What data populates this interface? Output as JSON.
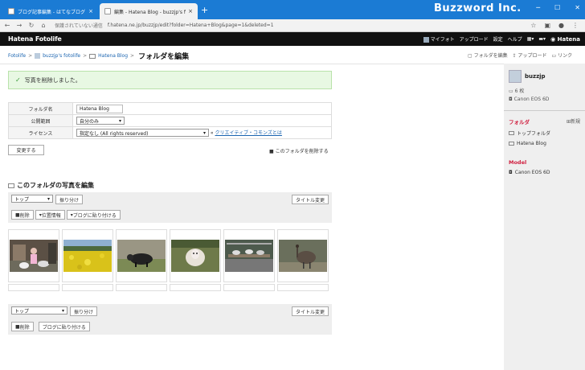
{
  "browser": {
    "tabs": [
      {
        "title": "ブログ記事編集 - はてなブログ"
      },
      {
        "title": "編集 - Hatena Blog - buzzjp's fotolife"
      }
    ],
    "brand": "Buzzword Inc.",
    "security": "保護されていない通信",
    "url": "f.hatena.ne.jp/buzzjp/edit?folder=Hatena+Blog&page=1&deleted=1"
  },
  "header": {
    "logo": "Hatena Fotolife",
    "nav": [
      "マイフォト",
      "アップロード",
      "設定",
      "ヘルプ"
    ],
    "hatena": "Hatena"
  },
  "breadcrumb": {
    "root": "Fotolife",
    "user": "buzzjp's fotolife",
    "folder": "Hatena Blog",
    "current": "フォルダを編集"
  },
  "actions": {
    "edit_folder": "フォルダを編集",
    "upload": "アップロード",
    "link": "リンク"
  },
  "notice": "写真を削除しました。",
  "form": {
    "rows": [
      {
        "label": "フォルダ名",
        "value": "Hatena Blog"
      },
      {
        "label": "公開範囲",
        "value": "自分のみ"
      },
      {
        "label": "ライセンス",
        "value": "指定なし (All rights reserved)"
      }
    ],
    "cc_link": "クリエイティブ・コモンズとは",
    "change_btn": "変更する",
    "delete_folder": "このフォルダを削除する"
  },
  "photos_section": {
    "title": "このフォルダの写真を編集",
    "move_select": "トップ",
    "move_btn": "振り分け",
    "title_btn": "タイトル変更",
    "delete_btn": "削除",
    "location_btn": "位置情報",
    "blog_btn": "ブログに貼り付ける",
    "bottom_blog_btn": "ブログに貼り付ける",
    "photos": [
      {
        "subject": "goats-and-person"
      },
      {
        "subject": "rapeseed-field"
      },
      {
        "subject": "black-sheep"
      },
      {
        "subject": "white-sheep"
      },
      {
        "subject": "goats-on-platform"
      },
      {
        "subject": "emu"
      }
    ]
  },
  "sidebar": {
    "username": "buzzjp",
    "count": "6 枚",
    "camera": "Canon EOS 6D",
    "folder_heading": "フォルダ",
    "new": "新規",
    "folders": [
      "トップフォルダ",
      "Hatena Blog"
    ],
    "model_heading": "Model",
    "model": "Canon EOS 6D"
  },
  "colors": {
    "titlebar": "#1b7bd4",
    "header": "#111111",
    "accent": "#d02040",
    "link": "#1a64b0",
    "notice_bg": "#e8f8e3"
  }
}
